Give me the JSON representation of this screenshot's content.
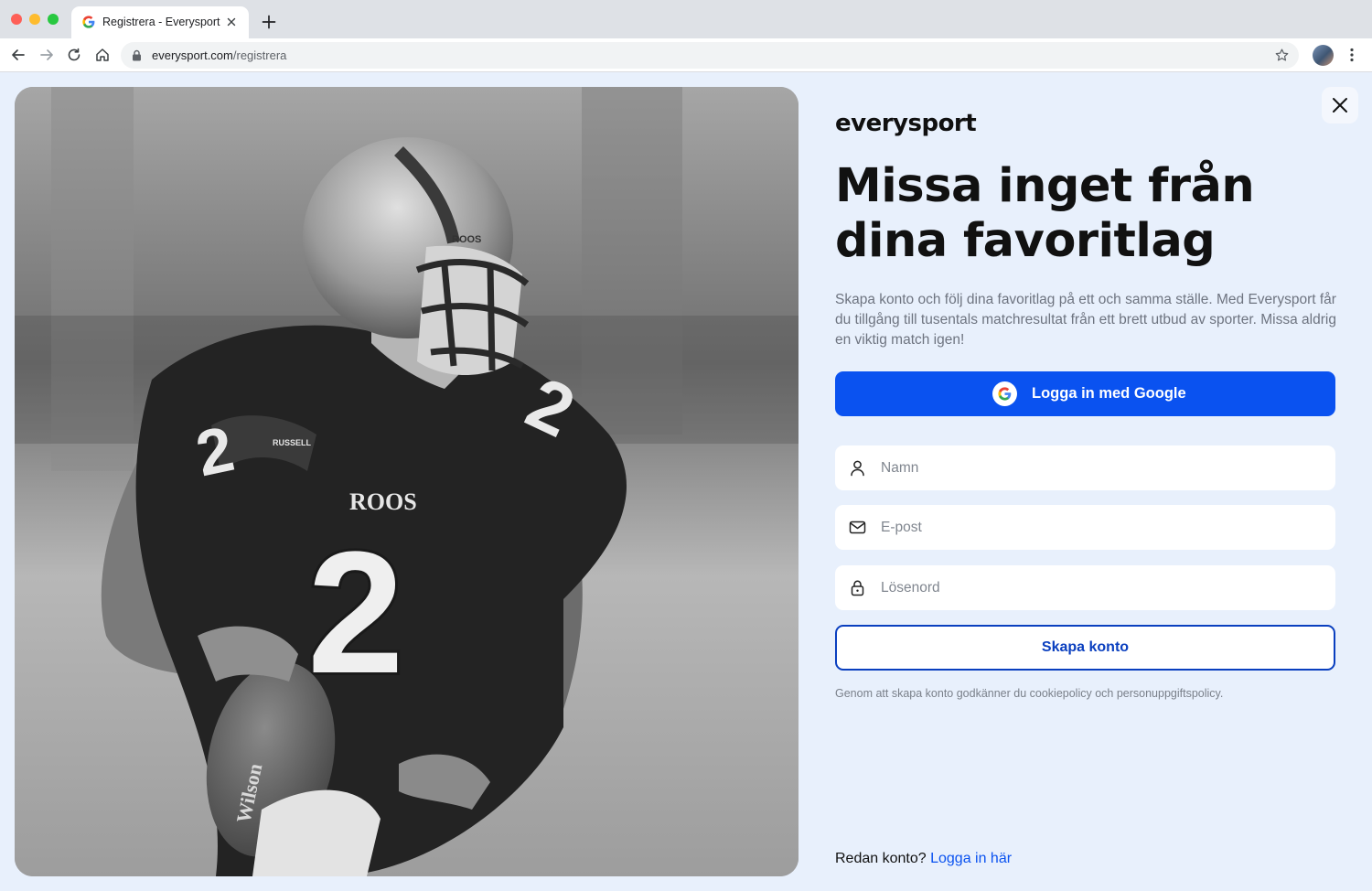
{
  "browser": {
    "tab_title": "Registrera - Everysport",
    "url_host": "everysport.com",
    "url_path": "/registrera"
  },
  "page": {
    "logo": "everysport",
    "headline": "Missa inget från dina favoritlag",
    "lead": "Skapa konto och följ dina favoritlag på ett och samma ställe. Med Everysport får du tillgång till tusentals matchresultat från ett brett utbud av sporter. Missa aldrig en viktig match igen!",
    "google_button_label": "Logga in med Google",
    "fields": {
      "name_placeholder": "Namn",
      "email_placeholder": "E-post",
      "password_placeholder": "Lösenord"
    },
    "create_button_label": "Skapa konto",
    "terms": "Genom att skapa konto godkänner du cookiepolicy och personuppgiftspolicy.",
    "existing_account_text": "Redan konto?",
    "login_link_label": "Logga in här"
  },
  "hero": {
    "jersey_text": "ROOS",
    "jersey_number": "2",
    "brand_mark": "RUSSELL",
    "ball_text": "Wilson"
  },
  "colors": {
    "page_background": "#e8f0fc",
    "primary_blue": "#0a52f0",
    "outline_blue": "#0a3fbf",
    "muted_text": "#6e7480"
  },
  "icons": {
    "tab_favicon": "google-g-icon",
    "back": "arrow-left-icon",
    "forward": "arrow-right-icon",
    "reload": "reload-icon",
    "home": "home-icon",
    "lock": "lock-icon",
    "bookmark": "star-icon",
    "menu": "more-vertical-icon",
    "close": "close-icon",
    "name_field": "user-icon",
    "email_field": "mail-icon",
    "password_field": "lock-icon"
  }
}
